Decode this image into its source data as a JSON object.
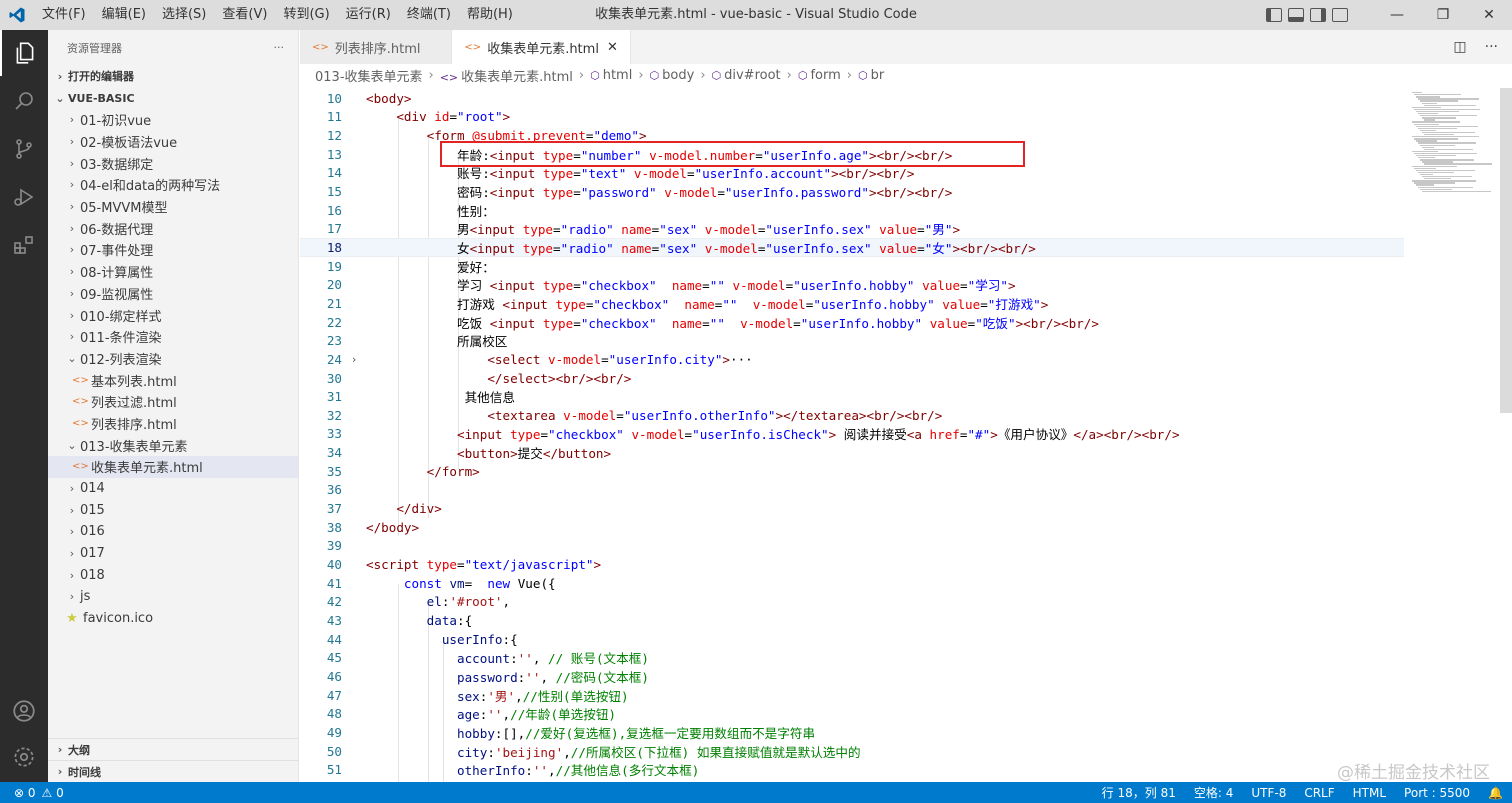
{
  "titlebar": {
    "menu": [
      "文件(F)",
      "编辑(E)",
      "选择(S)",
      "查看(V)",
      "转到(G)",
      "运行(R)",
      "终端(T)",
      "帮助(H)"
    ],
    "title": "收集表单元素.html - vue-basic - Visual Studio Code",
    "min": "—",
    "max": "❐",
    "close": "✕"
  },
  "sidebar": {
    "header": "资源管理器",
    "more": "···",
    "open_editors": "打开的编辑器",
    "root": "VUE-BASIC",
    "folders": [
      "01-初识vue",
      "02-模板语法vue",
      "03-数据绑定",
      "04-el和data的两种写法",
      "05-MVVM模型",
      "06-数据代理",
      "07-事件处理",
      "08-计算属性",
      "09-监视属性",
      "010-绑定样式",
      "011-条件渲染"
    ],
    "folder_012": "012-列表渲染",
    "files_012": [
      "基本列表.html",
      "列表过滤.html",
      "列表排序.html"
    ],
    "folder_013": "013-收集表单元素",
    "file_013": "收集表单元素.html",
    "more_folders": [
      "014",
      "015",
      "016",
      "017",
      "018",
      "js"
    ],
    "favicon": "favicon.ico",
    "outline": "大纲",
    "timeline": "时间线"
  },
  "tabs": [
    {
      "label": "列表排序.html",
      "active": false
    },
    {
      "label": "收集表单元素.html",
      "active": true
    }
  ],
  "breadcrumb": [
    "013-收集表单元素",
    "收集表单元素.html",
    "html",
    "body",
    "div#root",
    "form",
    "br"
  ],
  "editor": {
    "current_line": 18,
    "highlighted_line": 13
  },
  "statusbar": {
    "errors": "⊗ 0",
    "warnings": "⚠ 0",
    "position": "行 18，列 81",
    "spaces": "空格: 4",
    "encoding": "UTF-8",
    "eol": "CRLF",
    "language": "HTML",
    "port": "Port : 5500"
  },
  "watermark": "@稀土掘金技术社区"
}
